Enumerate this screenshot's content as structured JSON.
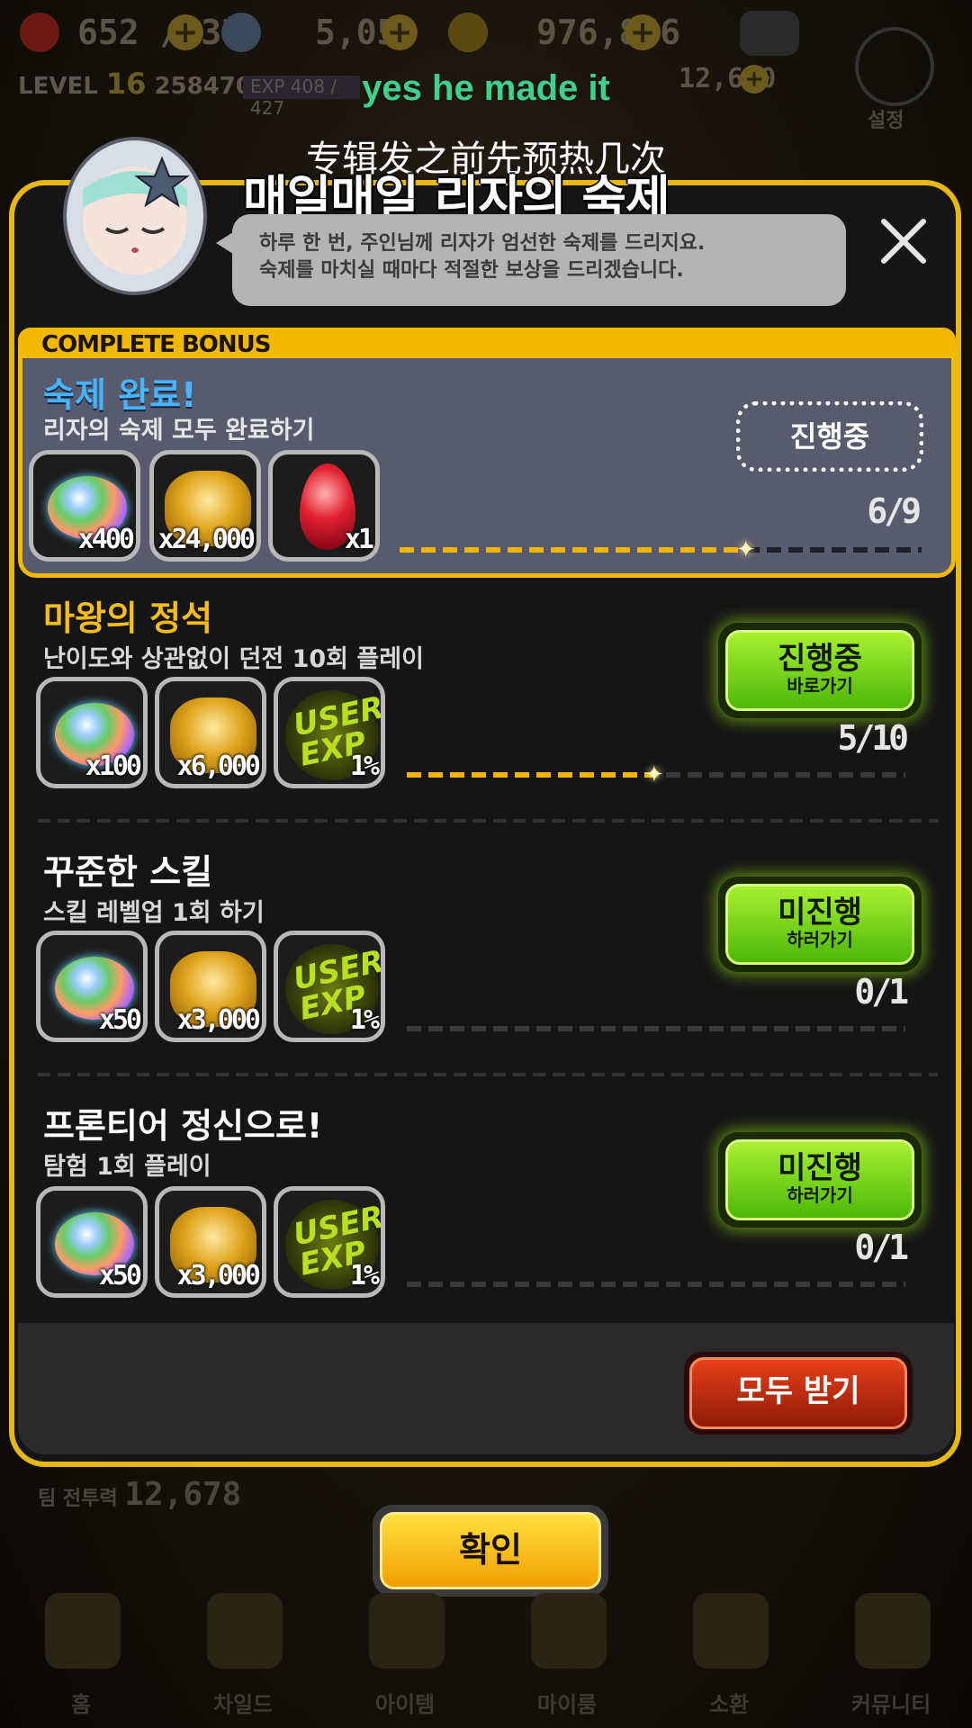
{
  "topbar": {
    "stamina": "652 / 37",
    "gems": "5,050",
    "gold": "976,856",
    "level_label": "LEVEL",
    "level": "16",
    "player_id": "2584703185",
    "exp": "EXP 408 / 427",
    "other": "12,600",
    "settings_label": "설정"
  },
  "overlay_subtitles": {
    "english": "yes he made it",
    "chinese": "专辑发之前先预热几次"
  },
  "dialog": {
    "title": "매일매일 리자의 숙제",
    "speech_line1": "하루 한 번, 주인님께 리자가 엄선한 숙제를 드리지요.",
    "speech_line2": "숙제를 마치실 때마다 적절한 보상을 드리겠습니다.",
    "complete_bonus": {
      "tab_label": "COMPLETE BONUS",
      "title": "숙제 완료!",
      "desc": "리자의 숙제 모두 완료하기",
      "status": "진행중",
      "progress_text": "6/9",
      "progress": 0.667,
      "rewards": [
        {
          "icon": "gem-icon",
          "qty": "x400"
        },
        {
          "icon": "gold-coins-icon",
          "qty": "x24,000"
        },
        {
          "icon": "ruby-icon",
          "qty": "x1"
        }
      ]
    },
    "missions": [
      {
        "title": "마왕의 정석",
        "desc": "난이도와 상관없이 던전 10회 플레이",
        "button_main": "진행중",
        "button_sub": "바로가기",
        "progress_text": "5/10",
        "progress": 0.5,
        "rewards": [
          {
            "icon": "gem-icon",
            "qty": "x100"
          },
          {
            "icon": "gold-coins-icon",
            "qty": "x6,000"
          },
          {
            "icon": "user-exp-icon",
            "qty": "1%"
          }
        ]
      },
      {
        "title": "꾸준한 스킬",
        "desc": "스킬 레벨업 1회 하기",
        "button_main": "미진행",
        "button_sub": "하러가기",
        "progress_text": "0/1",
        "progress": 0,
        "rewards": [
          {
            "icon": "gem-icon",
            "qty": "x50"
          },
          {
            "icon": "gold-coins-icon",
            "qty": "x3,000"
          },
          {
            "icon": "user-exp-icon",
            "qty": "1%"
          }
        ]
      },
      {
        "title": "프론티어 정신으로!",
        "desc": "탐험 1회 플레이",
        "button_main": "미진행",
        "button_sub": "하러가기",
        "progress_text": "0/1",
        "progress": 0,
        "rewards": [
          {
            "icon": "gem-icon",
            "qty": "x50"
          },
          {
            "icon": "gold-coins-icon",
            "qty": "x3,000"
          },
          {
            "icon": "user-exp-icon",
            "qty": "1%"
          }
        ]
      }
    ],
    "exp_icon_text": "USER EXP",
    "claim_all": "모두 받기"
  },
  "team_power_label": "팀 전투력",
  "team_power": "12,678",
  "confirm": "확인",
  "nav": [
    "홈",
    "차일드",
    "아이템",
    "마이룸",
    "소환",
    "커뮤니티"
  ],
  "colors": {
    "accent_gold": "#f3b800",
    "mission_green": "#6fd40c",
    "claim_red": "#c8300e",
    "title_blue": "#46b4ff"
  }
}
